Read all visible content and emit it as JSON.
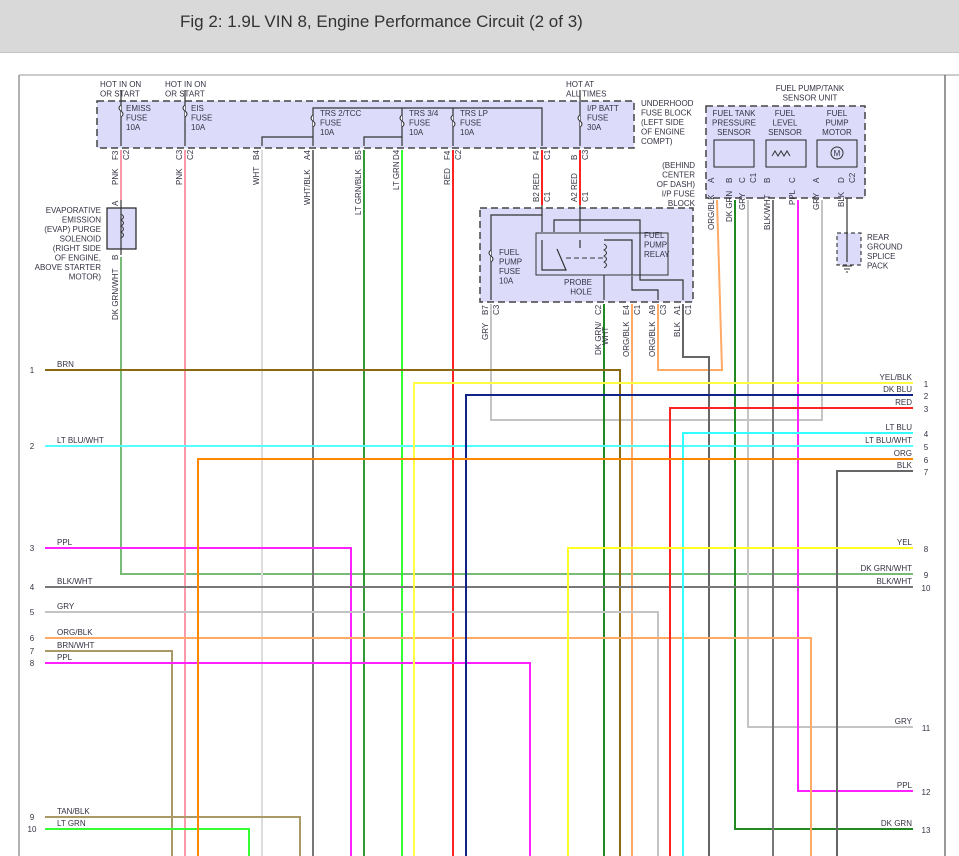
{
  "title": "Fig 2: 1.9L VIN 8, Engine Performance Circuit (2 of 3)",
  "colors": {
    "box_fill": "#dcdcfa",
    "PNK": "#ff99aa",
    "WHT": "#dddddd",
    "WHT/BLK": "#777777",
    "LT GRN/BLK": "#339933",
    "LT GRN": "#33ff33",
    "RED": "#ff2222",
    "GRY": "#c4c4c4",
    "DK GRN": "#228822",
    "DK GRN/WHT": "#77bb77",
    "ORG/BLK": "#ffaa66",
    "ORG": "#ff8800",
    "BLK": "#666666",
    "BLK/WHT": "#777777",
    "PPL": "#ff22ff",
    "BRN": "#8a6a10",
    "BRN/WHT": "#aa9966",
    "TAN/BLK": "#aa9966",
    "YEL": "#ffff22",
    "YEL/BLK": "#ffff44",
    "DK BLU": "#112288",
    "LT BLU": "#33ffff",
    "LT BLU/WHT": "#55ffff"
  },
  "hot_labels": [
    [
      "HOT IN ON",
      "OR START"
    ],
    [
      "HOT IN ON",
      "OR START"
    ],
    [
      "HOT AT",
      "ALL TIMES"
    ]
  ],
  "fuses": [
    [
      "EMISS",
      "FUSE",
      "10A"
    ],
    [
      "EIS",
      "FUSE",
      "10A"
    ],
    [
      "TRS 2/TCC",
      "FUSE",
      "10A"
    ],
    [
      "TRS 3/4",
      "FUSE",
      "10A"
    ],
    [
      "TRS LP",
      "FUSE",
      "10A"
    ],
    [
      "I/P BATT",
      "FUSE",
      "30A"
    ]
  ],
  "underhood_label": [
    "UNDERHOOD",
    "FUSE BLOCK",
    "(LEFT SIDE",
    "OF ENGINE",
    "COMPT)"
  ],
  "ip_block_label": [
    "(BEHIND",
    "CENTER",
    "OF DASH)",
    "I/P FUSE",
    "BLOCK"
  ],
  "relay": {
    "fuse": [
      "FUEL",
      "PUMP",
      "FUSE",
      "10A"
    ],
    "relay": [
      "FUEL",
      "PUMP",
      "RELAY"
    ],
    "probe": [
      "PROBE",
      "HOLE"
    ]
  },
  "fuel_unit": {
    "title": [
      "FUEL PUMP/TANK",
      "SENSOR UNIT"
    ],
    "pressure": [
      "FUEL TANK",
      "PRESSURE",
      "SENSOR"
    ],
    "level": [
      "FUEL",
      "LEVEL",
      "SENSOR"
    ],
    "motor": [
      "FUEL",
      "PUMP",
      "MOTOR"
    ],
    "motor_symbol": "M"
  },
  "ground_label": [
    "REAR",
    "GROUND",
    "SPLICE",
    "PACK"
  ],
  "evap_label": [
    "EVAPORATIVE",
    "EMISSION",
    "(EVAP) PURGE",
    "SOLENOID",
    "(RIGHT SIDE",
    "OF ENGINE,",
    "ABOVE STARTER",
    "MOTOR)"
  ],
  "pins": [
    {
      "pin": "F3",
      "conn": "C2",
      "wire": "PNK"
    },
    {
      "pin": "C3",
      "conn": "C2",
      "wire": "PNK"
    },
    {
      "pin": "B4",
      "conn": "",
      "wire": "WHT"
    },
    {
      "pin": "A4",
      "conn": "",
      "wire": "WHT/BLK"
    },
    {
      "pin": "B5",
      "conn": "",
      "wire": "LT GRN/BLK"
    },
    {
      "pin": "D4",
      "conn": "",
      "wire": "LT GRN"
    },
    {
      "pin": "F4",
      "conn": "C2",
      "wire": "RED"
    },
    {
      "pin": "F4",
      "conn": "C1",
      "wire": "RED"
    },
    {
      "pin": "B",
      "conn": "C3",
      "wire": "RED"
    },
    {
      "pin": "B2",
      "conn": "C1",
      "wire": ""
    },
    {
      "pin": "A2",
      "conn": "C1",
      "wire": ""
    },
    {
      "pin": "A",
      "conn": "",
      "wire": "ORG/BLK"
    },
    {
      "pin": "B",
      "conn": "",
      "wire": "DK GRN"
    },
    {
      "pin": "C",
      "conn": "C1",
      "wire": "GRY"
    },
    {
      "pin": "B",
      "conn": "",
      "wire": "BLK/WHT"
    },
    {
      "pin": "C",
      "conn": "",
      "wire": "PPL"
    },
    {
      "pin": "A",
      "conn": "",
      "wire": "GRY"
    },
    {
      "pin": "D",
      "conn": "C2",
      "wire": "BLK"
    },
    {
      "pin": "B7",
      "conn": "C3",
      "wire": "GRY"
    },
    {
      "pin": "C2",
      "conn": "",
      "wire": "DK GRN/"
    },
    {
      "pin": "",
      "conn": "",
      "wire": "WHT"
    },
    {
      "pin": "E4",
      "conn": "C1",
      "wire": "ORG/BLK"
    },
    {
      "pin": "A9",
      "conn": "C3",
      "wire": "ORG/BLK"
    },
    {
      "pin": "A1",
      "conn": "C1",
      "wire": "BLK"
    },
    {
      "pin": "A",
      "conn": "",
      "wire": ""
    },
    {
      "pin": "B",
      "conn": "",
      "wire": "DK GRN/WHT"
    }
  ],
  "left_rows": [
    {
      "num": "1",
      "label": "BRN"
    },
    {
      "num": "2",
      "label": "LT BLU/WHT"
    },
    {
      "num": "3",
      "label": "PPL"
    },
    {
      "num": "4",
      "label": "BLK/WHT"
    },
    {
      "num": "5",
      "label": "GRY"
    },
    {
      "num": "6",
      "label": "ORG/BLK"
    },
    {
      "num": "7",
      "label": "BRN/WHT"
    },
    {
      "num": "8",
      "label": "PPL"
    },
    {
      "num": "9",
      "label": "TAN/BLK"
    },
    {
      "num": "10",
      "label": "LT GRN"
    }
  ],
  "right_rows": [
    {
      "num": "1",
      "label": "YEL/BLK"
    },
    {
      "num": "2",
      "label": "DK BLU"
    },
    {
      "num": "3",
      "label": "RED"
    },
    {
      "num": "4",
      "label": "LT BLU"
    },
    {
      "num": "5",
      "label": "LT BLU/WHT"
    },
    {
      "num": "6",
      "label": "ORG"
    },
    {
      "num": "7",
      "label": "BLK"
    },
    {
      "num": "8",
      "label": "YEL"
    },
    {
      "num": "9",
      "label": "DK GRN/WHT"
    },
    {
      "num": "10",
      "label": "BLK/WHT"
    },
    {
      "num": "11",
      "label": "GRY"
    },
    {
      "num": "12",
      "label": "PPL"
    },
    {
      "num": "13",
      "label": "DK GRN"
    }
  ]
}
